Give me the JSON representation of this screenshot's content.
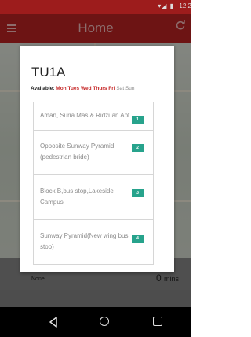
{
  "status_bar": {
    "time": "12:2"
  },
  "app_bar": {
    "title": "Home"
  },
  "dialog": {
    "title": "TU1A",
    "available_label": "Available:",
    "days_on": [
      "Mon",
      "Tues",
      "Wed",
      "Thurs",
      "Fri"
    ],
    "days_off": [
      "Sat",
      "Sun"
    ],
    "stops": [
      {
        "name": "Aman, Suria Mas & Ridzuan Apt",
        "number": "1"
      },
      {
        "name": "Opposite Sunway Pyramid (pedestrian bride)",
        "number": "2"
      },
      {
        "name": "Block B,bus stop,Lakeside Campus",
        "number": "3"
      },
      {
        "name": "Sunway Pyramid(New wing bus stop)",
        "number": "4"
      }
    ]
  },
  "background_list": {
    "route": "None",
    "time_value": "0",
    "time_unit": "mins"
  },
  "colors": {
    "app_bar": "#a81f1f",
    "badge": "#27a38c",
    "available_day": "#c62828",
    "unavailable_day": "#8a8a8a"
  },
  "icons": {
    "menu": "hamburger-icon",
    "refresh": "refresh-icon",
    "back": "back-triangle-icon",
    "home": "home-circle-icon",
    "recent": "recent-apps-icon"
  }
}
